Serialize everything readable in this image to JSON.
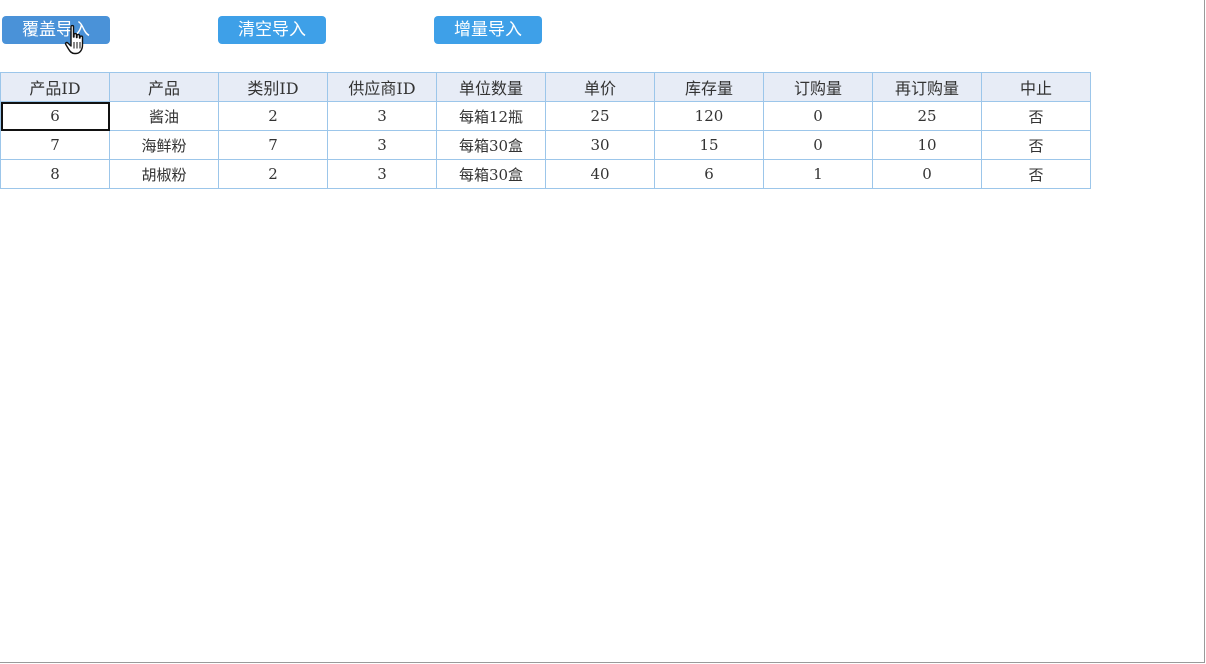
{
  "toolbar": {
    "overwrite_label": "覆盖导入",
    "clear_label": "清空导入",
    "append_label": "增量导入"
  },
  "colors": {
    "overwrite_button": "#4a92d8",
    "button": "#3ea0e8",
    "header_bg": "#e7ecf6",
    "grid_border": "#9cc6ea"
  },
  "cursor_icon": "hand-pointer-icon",
  "table": {
    "headers": [
      "产品ID",
      "产品",
      "类别ID",
      "供应商ID",
      "单位数量",
      "单价",
      "库存量",
      "订购量",
      "再订购量",
      "中止"
    ],
    "rows": [
      [
        "6",
        "酱油",
        "2",
        "3",
        "每箱12瓶",
        "25",
        "120",
        "0",
        "25",
        "否"
      ],
      [
        "7",
        "海鲜粉",
        "7",
        "3",
        "每箱30盒",
        "30",
        "15",
        "0",
        "10",
        "否"
      ],
      [
        "8",
        "胡椒粉",
        "2",
        "3",
        "每箱30盒",
        "40",
        "6",
        "1",
        "0",
        "否"
      ]
    ]
  }
}
